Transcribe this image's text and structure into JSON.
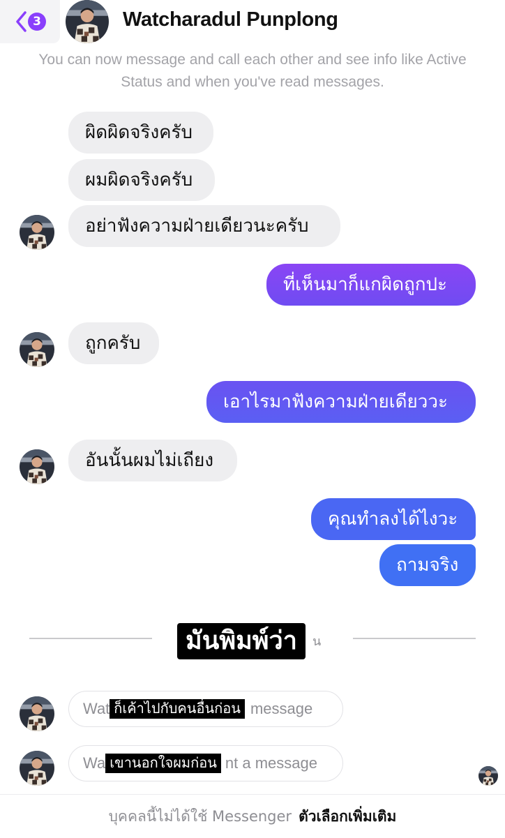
{
  "header": {
    "unread_count": "3",
    "contact_name": "Watcharadul Punplong",
    "notice": "You can now message and call each other and see info like Active Status and when you've read messages."
  },
  "messages": {
    "in_1": "ผิดผิดจริงครับ",
    "in_2": "ผมผิดจริงครับ",
    "in_3": "อย่าฟังความฝ่ายเดียวนะครับ",
    "out_1": "ที่เห็นมาก็แกผิดถูกปะ",
    "in_4": "ถูกครับ",
    "out_2": "เอาไรมาฟังความฝ่ายเดียววะ",
    "in_5": "อันนั้นผมไม่เถียง",
    "out_3": "คุณทำลงได้ไงวะ",
    "out_4": "ถามจริง"
  },
  "divider": {
    "overlay": "มันพิมพ์ว่า",
    "underlying_tail": "น"
  },
  "unsent": {
    "row1_prefix": "Wat",
    "row1_overlay": "ก็เค้าไปกับคนอื่นก่อน",
    "row1_suffix": "message",
    "row2_prefix": "Wa",
    "row2_overlay": "เขานอกใจผมก่อน",
    "row2_suffix": "nt a message"
  },
  "footer": {
    "note": "บุคคลนี้ไม่ได้ใช้ Messenger",
    "more_options": "ตัวเลือกเพิ่มเติม"
  },
  "colors": {
    "accent_purple": "#8a3ffc",
    "bubble_out_top": "#7a45f2",
    "bubble_out_bottom": "#3f6cf4",
    "bubble_in": "#eeeef0"
  }
}
